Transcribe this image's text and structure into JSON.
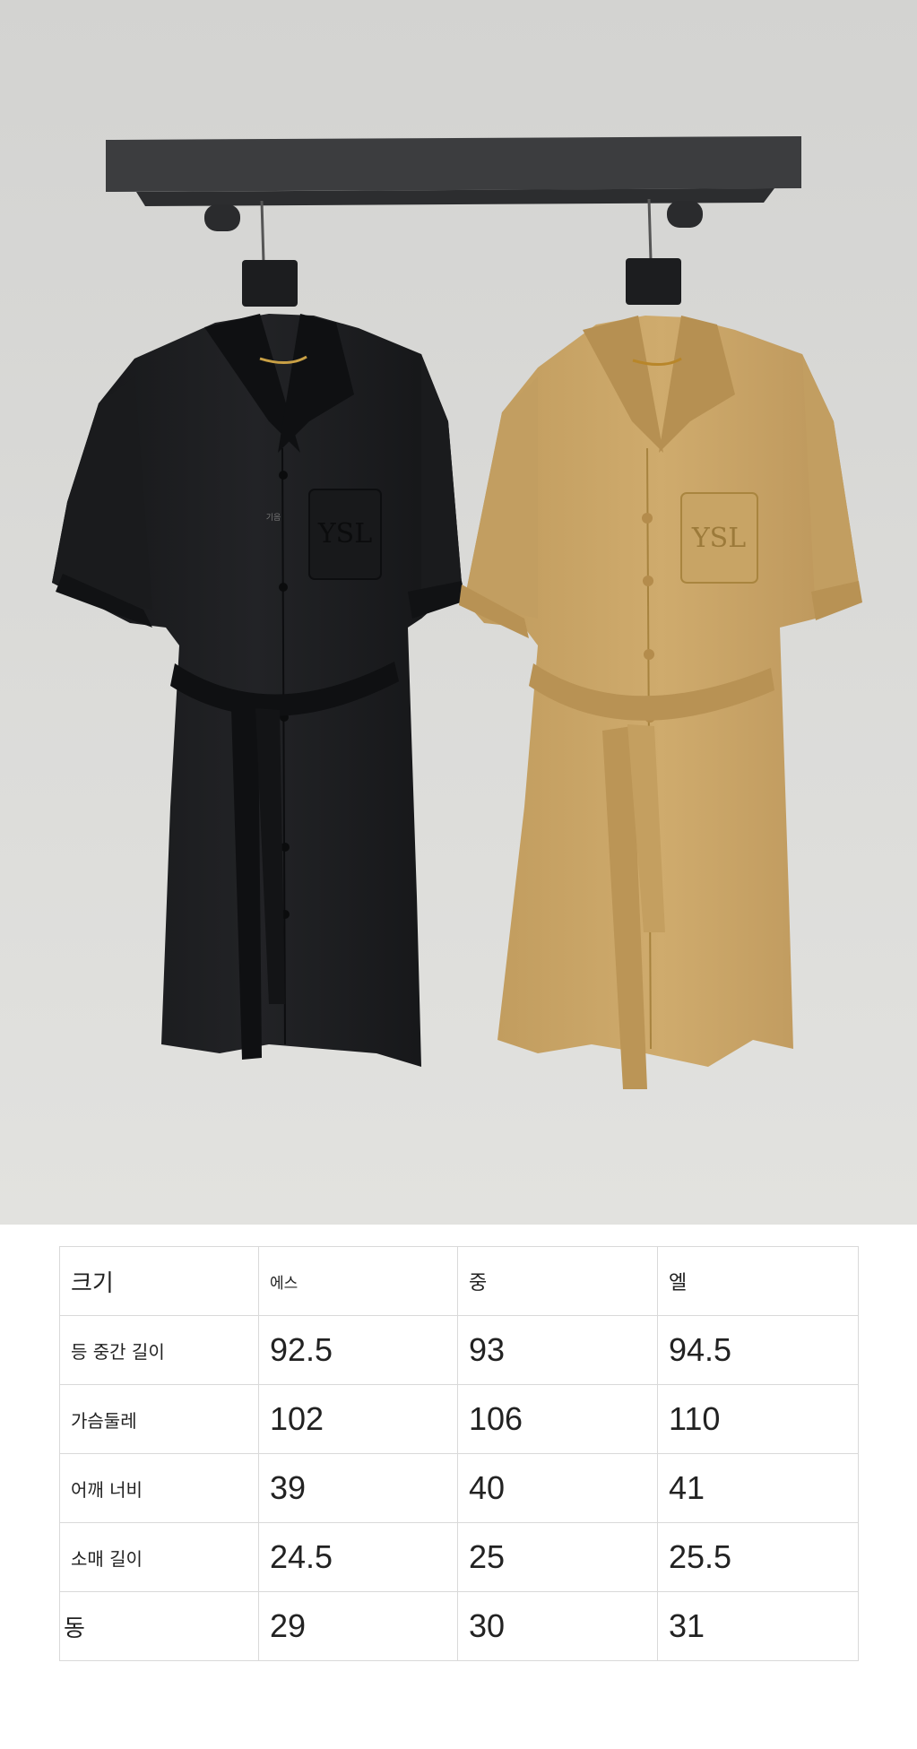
{
  "photo": {
    "pocket_logo": "YSL",
    "tag_text": "기음",
    "colors": {
      "black_dress": "#1b1c1e",
      "tan_dress": "#c9a467",
      "wall": "#dcdcda",
      "rail": "#3a3b3d"
    }
  },
  "size_table": {
    "header": {
      "label": "크기",
      "sizes": [
        "에스",
        "중",
        "엘"
      ]
    },
    "rows": [
      {
        "label": "등 중간 길이",
        "values": [
          "92.5",
          "93",
          "94.5"
        ]
      },
      {
        "label": "가슴둘레",
        "values": [
          "102",
          "106",
          "110"
        ]
      },
      {
        "label": "어깨 너비",
        "values": [
          "39",
          "40",
          "41"
        ]
      },
      {
        "label": "소매 길이",
        "values": [
          "24.5",
          "25",
          "25.5"
        ]
      },
      {
        "label": "동",
        "values": [
          "29",
          "30",
          "31"
        ]
      }
    ]
  }
}
